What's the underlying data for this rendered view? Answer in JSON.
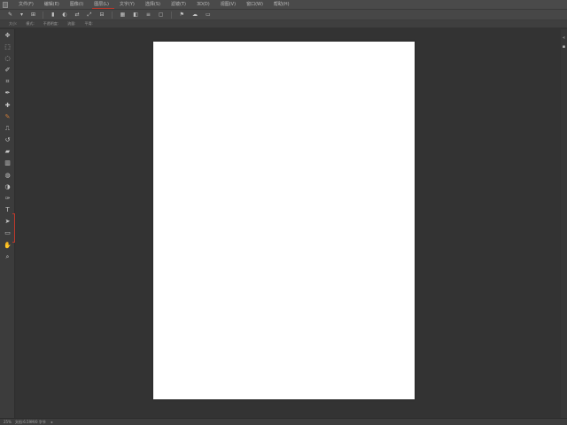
{
  "menubar": {
    "items": [
      {
        "label": "文件(F)"
      },
      {
        "label": "编辑(E)"
      },
      {
        "label": "图像(I)"
      },
      {
        "label": "图层(L)",
        "active": true
      },
      {
        "label": "文字(Y)"
      },
      {
        "label": "选择(S)"
      },
      {
        "label": "滤镜(T)"
      },
      {
        "label": "3D(D)"
      },
      {
        "label": "视图(V)"
      },
      {
        "label": "窗口(W)"
      },
      {
        "label": "帮助(H)"
      }
    ]
  },
  "options_bar": {
    "buttons": [
      "✎",
      "▾",
      "⊞",
      "▮",
      "◐",
      "⇄",
      "⤢",
      "⊟",
      "▦",
      "◧",
      "≡",
      "▢",
      "⚑",
      "☁",
      "▭"
    ],
    "row2_items": [
      "大小:",
      "模式:",
      "不透明度:",
      "流量:",
      "平滑:"
    ]
  },
  "toolbar": {
    "tools": [
      {
        "name": "move-tool",
        "glyph": "✥",
        "accent": false
      },
      {
        "name": "marquee-tool",
        "glyph": "⬚",
        "accent": false
      },
      {
        "name": "lasso-tool",
        "glyph": "◌",
        "accent": false
      },
      {
        "name": "quick-select-tool",
        "glyph": "✐",
        "accent": false
      },
      {
        "name": "crop-tool",
        "glyph": "⌗",
        "accent": false
      },
      {
        "name": "eyedropper-tool",
        "glyph": "✒",
        "accent": false
      },
      {
        "name": "healing-tool",
        "glyph": "✚",
        "accent": false
      },
      {
        "name": "brush-tool",
        "glyph": "✎",
        "accent": true
      },
      {
        "name": "clone-stamp-tool",
        "glyph": "⎍",
        "accent": false
      },
      {
        "name": "history-brush-tool",
        "glyph": "↺",
        "accent": false
      },
      {
        "name": "eraser-tool",
        "glyph": "▰",
        "accent": false
      },
      {
        "name": "gradient-tool",
        "glyph": "▥",
        "accent": false
      },
      {
        "name": "blur-tool",
        "glyph": "◍",
        "accent": false
      },
      {
        "name": "dodge-tool",
        "glyph": "◑",
        "accent": false
      },
      {
        "name": "pen-tool",
        "glyph": "✑",
        "accent": false
      },
      {
        "name": "type-tool",
        "glyph": "T",
        "accent": false
      },
      {
        "name": "path-select-tool",
        "glyph": "➤",
        "accent": false
      },
      {
        "name": "shape-tool",
        "glyph": "▭",
        "accent": false
      },
      {
        "name": "hand-tool",
        "glyph": "✋",
        "accent": false
      },
      {
        "name": "zoom-tool",
        "glyph": "⌕",
        "accent": false
      }
    ]
  },
  "statusbar": {
    "zoom": "25%",
    "doc_info": "文档:6.59M/0 字节"
  },
  "colors": {
    "workspace": "#333333",
    "document": "#ffffff",
    "accent_red": "#c0392b",
    "brush_accent": "#c97a3a"
  }
}
